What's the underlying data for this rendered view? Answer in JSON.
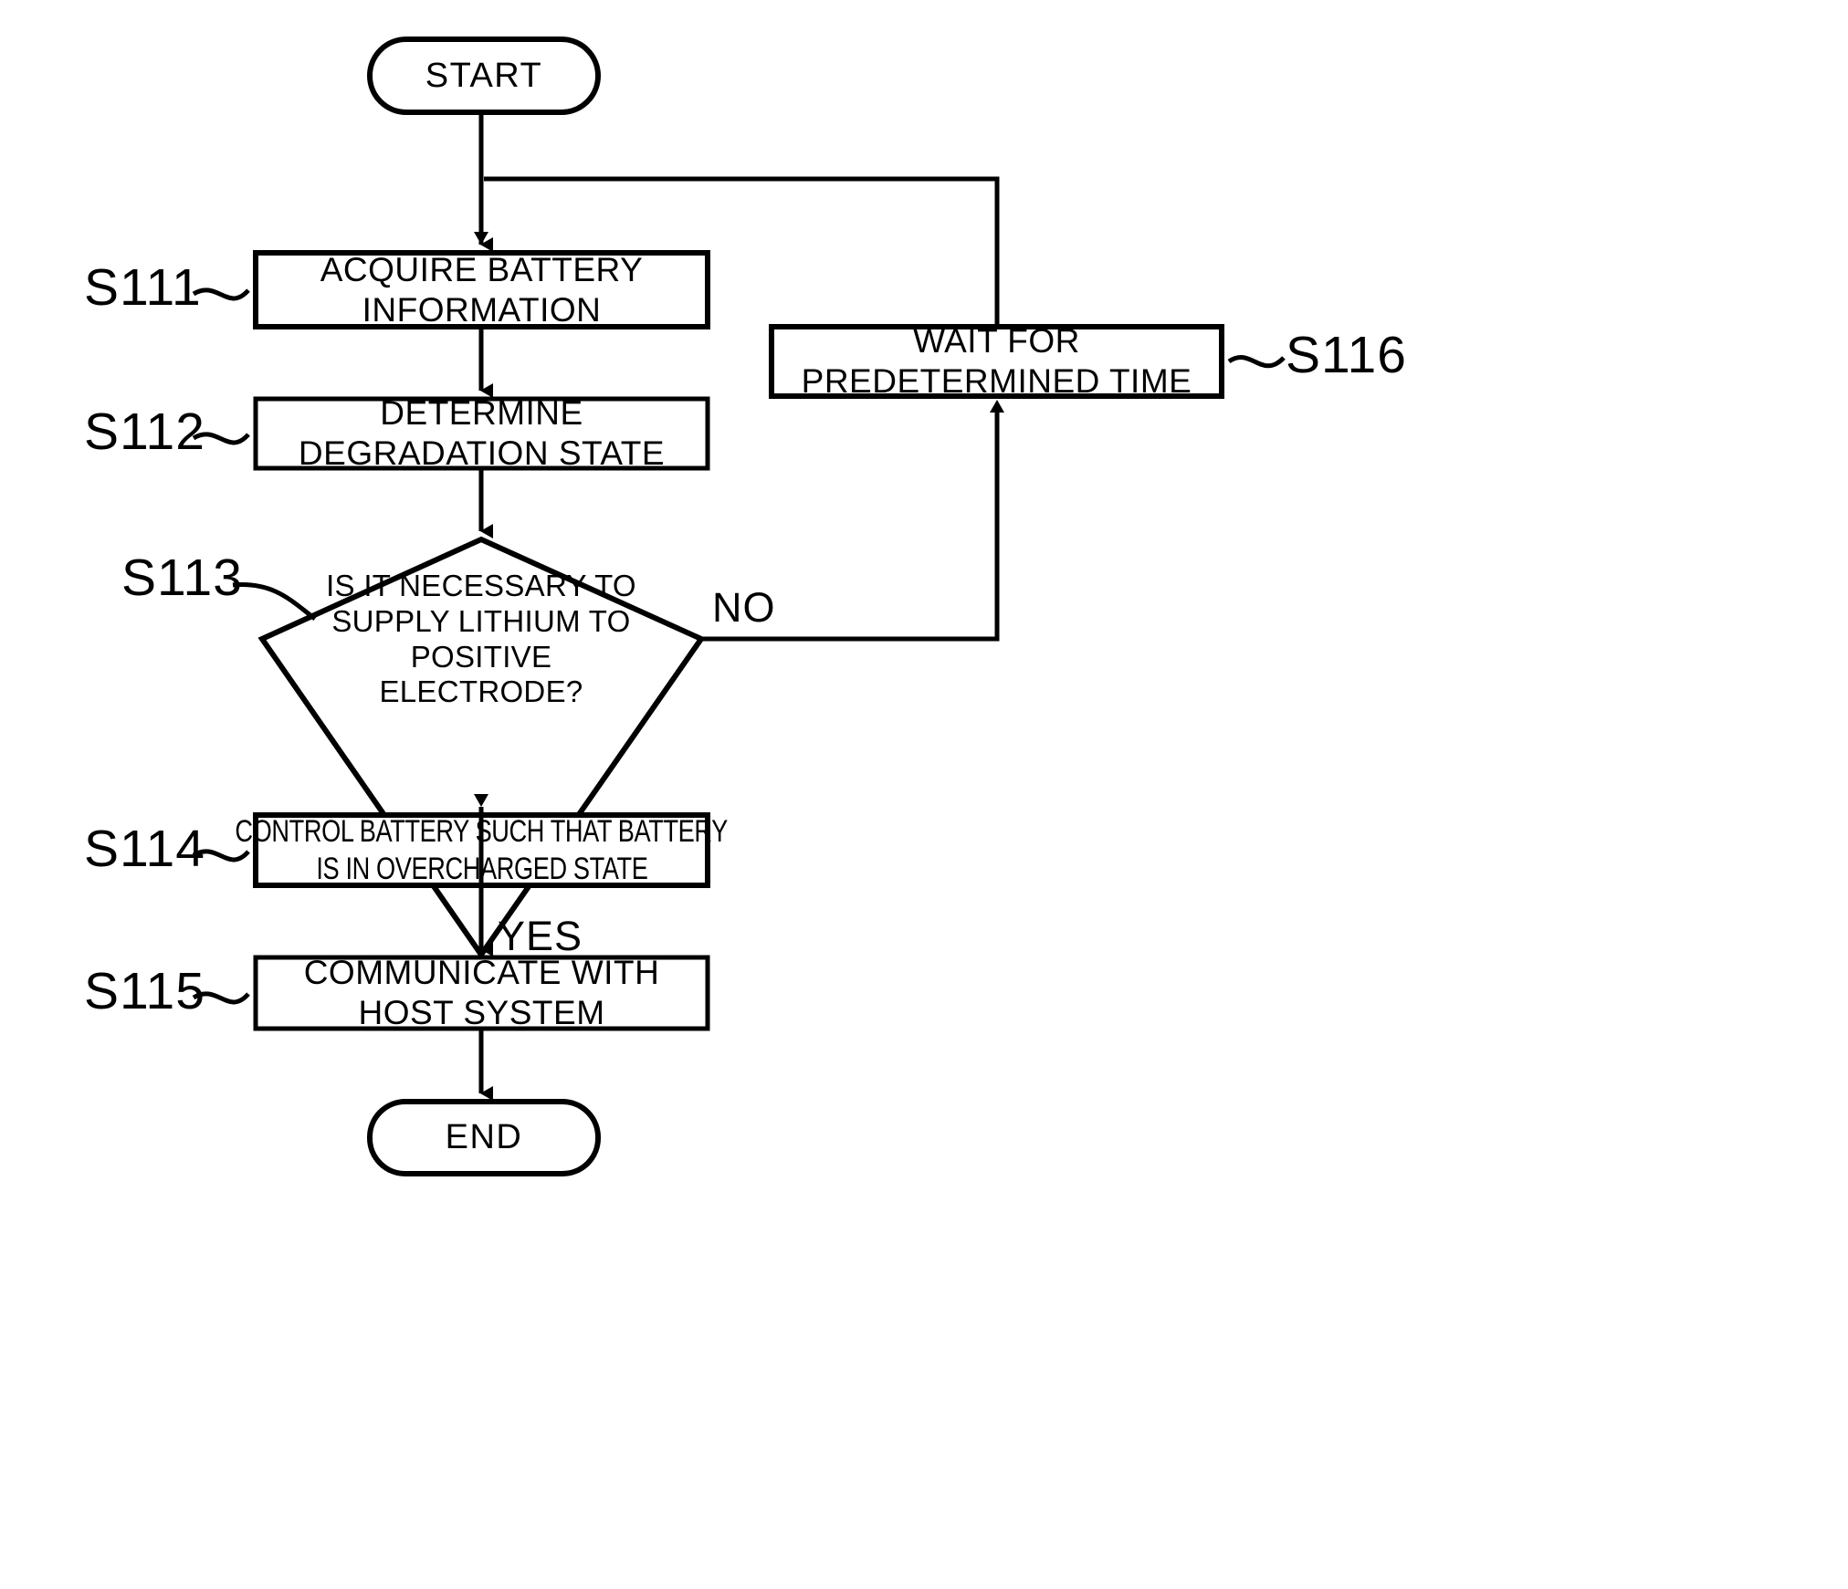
{
  "figure": {
    "type": "flowchart",
    "orientation": "vertical"
  },
  "nodes": {
    "start": {
      "label": "START",
      "shape": "terminal"
    },
    "s111": {
      "label": "ACQUIRE BATTERY INFORMATION",
      "shape": "process"
    },
    "s112": {
      "label": "DETERMINE DEGRADATION STATE",
      "shape": "process"
    },
    "s113": {
      "line1": "IS IT NECESSARY TO",
      "line2": "SUPPLY LITHIUM TO POSITIVE",
      "line3": "ELECTRODE?",
      "shape": "decision"
    },
    "s114": {
      "line1": "CONTROL BATTERY SUCH THAT BATTERY",
      "line2": "IS IN OVERCHARGED STATE",
      "shape": "process"
    },
    "s115": {
      "line1": "COMMUNICATE WITH",
      "line2": "HOST SYSTEM",
      "shape": "process"
    },
    "s116": {
      "label": "WAIT FOR PREDETERMINED TIME",
      "shape": "process"
    },
    "end": {
      "label": "END",
      "shape": "terminal"
    }
  },
  "step_labels": {
    "s111": "S111",
    "s112": "S112",
    "s113": "S113",
    "s114": "S114",
    "s115": "S115",
    "s116": "S116"
  },
  "branch_labels": {
    "no": "NO",
    "yes": "YES"
  },
  "colors": {
    "stroke": "#000000",
    "background": "#ffffff",
    "text": "#000000"
  }
}
